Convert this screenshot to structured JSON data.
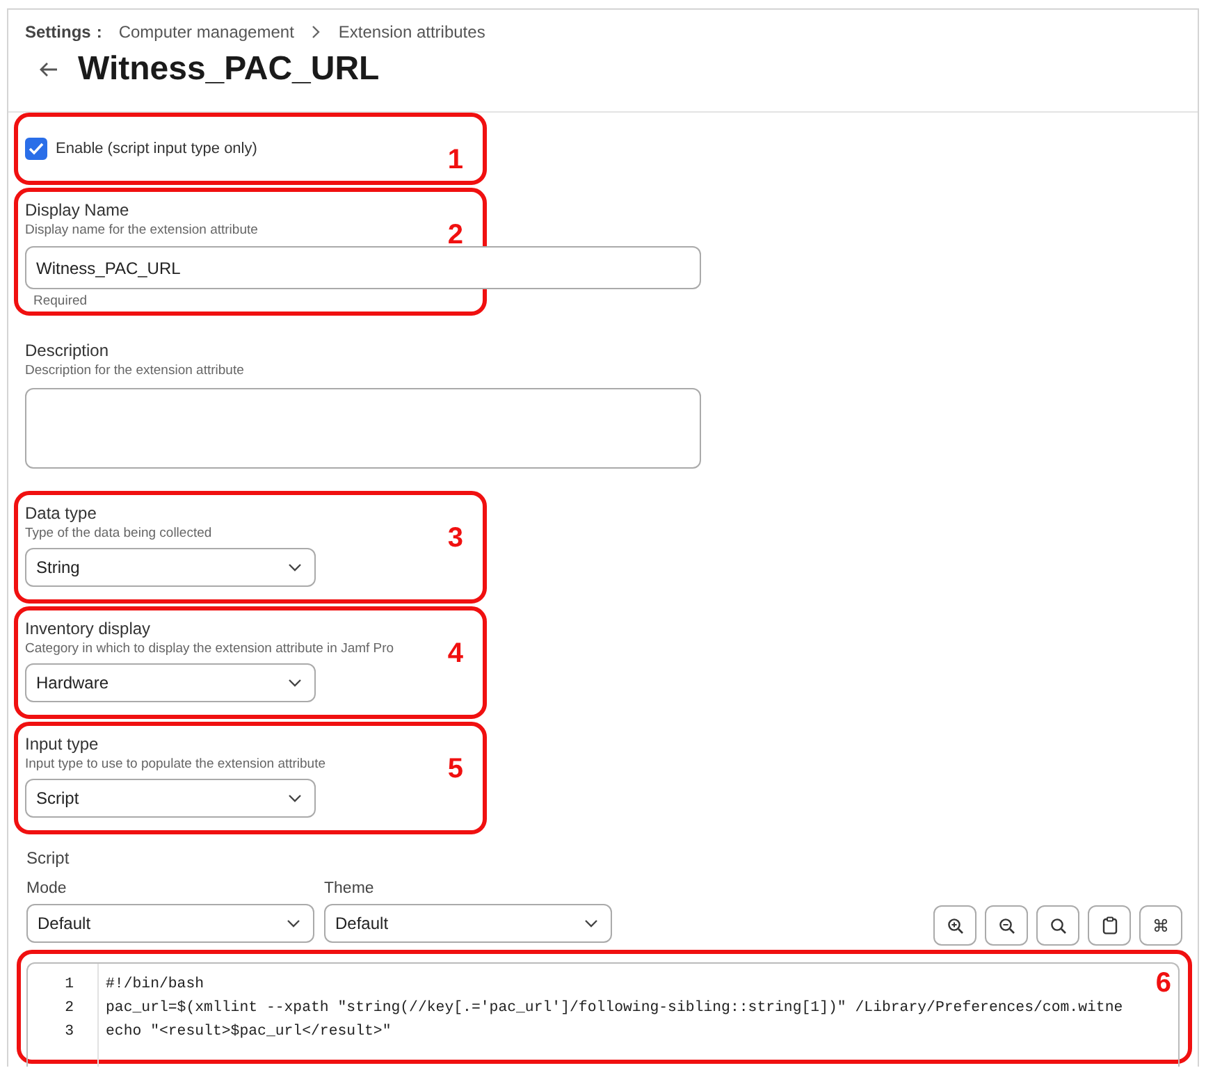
{
  "breadcrumb": {
    "root": "Settings",
    "separator": ":",
    "items": [
      "Computer management",
      "Extension attributes"
    ]
  },
  "title": "Witness_PAC_URL",
  "sections": [
    {
      "kind": "checkbox",
      "label": "Enable (script input type only)",
      "checked": true,
      "callout": "1"
    },
    {
      "kind": "text",
      "label": "Display Name",
      "hint": "Display name for the extension attribute",
      "value": "Witness_PAC_URL",
      "helper": "Required",
      "callout": "2"
    },
    {
      "kind": "textarea",
      "label": "Description",
      "hint": "Description for the extension attribute"
    },
    {
      "kind": "select",
      "label": "Data type",
      "hint": "Type of the data being collected",
      "value": "String",
      "callout": "3"
    },
    {
      "kind": "select",
      "label": "Inventory display",
      "hint": "Category in which to display the extension attribute in Jamf Pro",
      "value": "Hardware",
      "callout": "4"
    },
    {
      "kind": "select",
      "label": "Input type",
      "hint": "Input type to use to populate the extension attribute",
      "value": "Script",
      "callout": "5"
    }
  ],
  "script": {
    "label": "Script",
    "selects": [
      {
        "label": "Mode",
        "value": "Default"
      },
      {
        "label": "Theme",
        "value": "Default"
      }
    ],
    "tools": [
      {
        "kind": "zoom-in"
      },
      {
        "kind": "zoom-out"
      },
      {
        "kind": "search"
      },
      {
        "kind": "clipboard"
      },
      {
        "kind": "keys",
        "glyph": "⌘"
      }
    ],
    "callout": "6",
    "lines": [
      {
        "number": "1",
        "code": "#!/bin/bash"
      },
      {
        "number": "2",
        "code": "pac_url=$(xmllint --xpath \"string(//key[.='pac_url']/following-sibling::string[1])\" /Library/Preferences/com.witne"
      },
      {
        "number": "3",
        "code": "echo \"<result>$pac_url</result>\""
      }
    ]
  }
}
